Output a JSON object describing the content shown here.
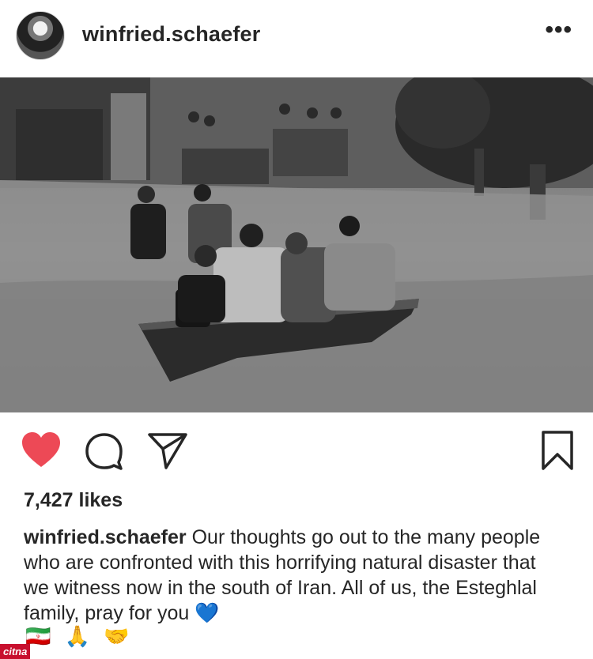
{
  "header": {
    "username": "winfried.schaefer",
    "more_icon": "more-horizontal-icon",
    "more_label": "•••"
  },
  "photo": {
    "subject": "black-and-white flood photo"
  },
  "actions": {
    "like_icon": "heart-filled-icon",
    "like_color": "#ed4956",
    "comment_icon": "comment-icon",
    "share_icon": "paper-plane-icon",
    "save_icon": "bookmark-icon"
  },
  "post": {
    "likes": "7,427 likes",
    "caption_user": "winfried.schaefer",
    "caption_text": "Our thoughts go out to the many people who are confronted with this horrifying natural disaster that we witness now in the south of Iran. All of us, the Esteghlal family, pray for you",
    "heart_emoji": "💙",
    "emojis": [
      "🇮🇷",
      "🙏",
      "🤝"
    ]
  },
  "watermark": {
    "text": "citna"
  }
}
